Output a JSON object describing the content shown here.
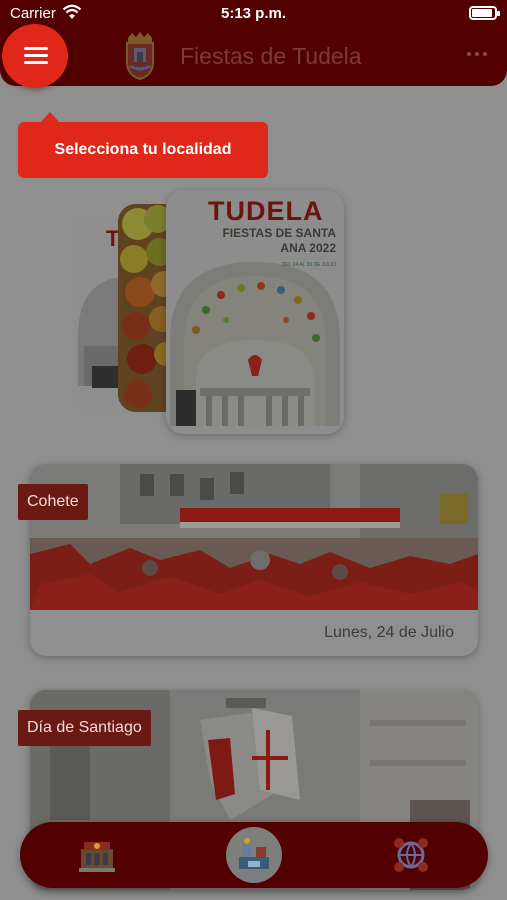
{
  "status_bar": {
    "carrier": "Carrier",
    "time": "5:13 p.m.",
    "wifi_icon": "wifi-icon",
    "battery_icon": "battery-icon"
  },
  "header": {
    "title": "Fiestas de Tudela",
    "menu_icon": "hamburger-menu-icon",
    "crest_icon": "coat-of-arms-icon",
    "more_icon": "more-dots-icon"
  },
  "tooltip": {
    "text": "Selecciona tu localidad"
  },
  "poster": {
    "brand": "TUDELA",
    "subtitle_line1": "FIESTAS DE SANTA",
    "subtitle_line2": "ANA 2022",
    "date_line": "DEL 24 AL 30 DE JULIO"
  },
  "events": [
    {
      "tag": "Cohete",
      "date": "Lunes, 24 de Julio"
    },
    {
      "tag": "Día de Santiago"
    }
  ],
  "bottom_nav": [
    {
      "icon": "town-hall-icon"
    },
    {
      "icon": "festival-program-icon"
    },
    {
      "icon": "global-contact-icon"
    }
  ],
  "colors": {
    "header": "#520000",
    "accent": "#e0281a",
    "tag": "#6b1a13",
    "overlay_background": "#8f8f8f"
  }
}
